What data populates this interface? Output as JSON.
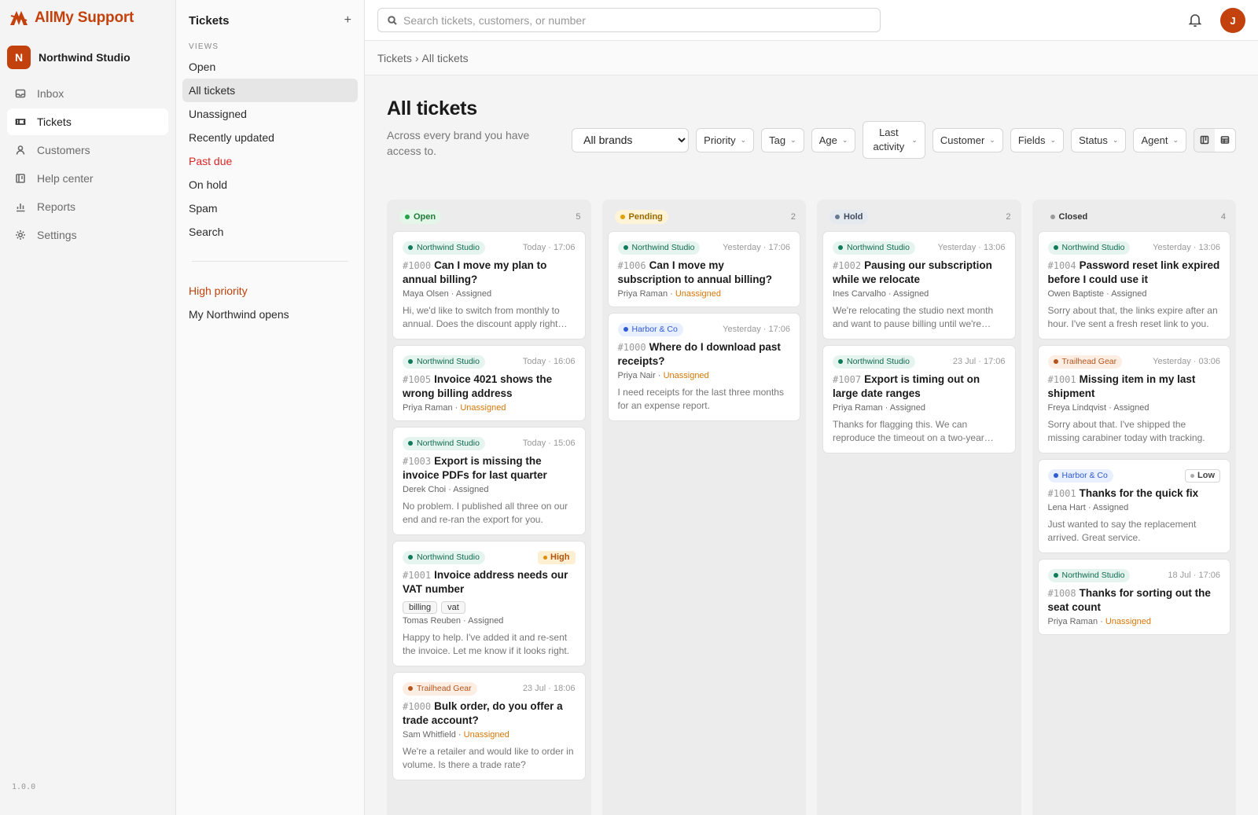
{
  "app": {
    "name": "AllMy Support",
    "version": "1.0.0",
    "accent": "#c2410c"
  },
  "workspace": {
    "initial": "N",
    "name": "Northwind Studio"
  },
  "nav": [
    {
      "label": "Inbox",
      "icon": "inbox-icon",
      "active": false
    },
    {
      "label": "Tickets",
      "icon": "ticket-icon",
      "active": true
    },
    {
      "label": "Customers",
      "icon": "user-icon",
      "active": false
    },
    {
      "label": "Help center",
      "icon": "book-icon",
      "active": false
    },
    {
      "label": "Reports",
      "icon": "bar-chart-icon",
      "active": false
    },
    {
      "label": "Settings",
      "icon": "gear-icon",
      "active": false
    }
  ],
  "views_panel": {
    "title": "Tickets",
    "section_label": "VIEWS",
    "views": [
      {
        "label": "Open",
        "style": "normal",
        "active": false
      },
      {
        "label": "All tickets",
        "style": "normal",
        "active": true
      },
      {
        "label": "Unassigned",
        "style": "normal",
        "active": false
      },
      {
        "label": "Recently updated",
        "style": "normal",
        "active": false
      },
      {
        "label": "Past due",
        "style": "red",
        "active": false
      },
      {
        "label": "On hold",
        "style": "normal",
        "active": false
      },
      {
        "label": "Spam",
        "style": "normal",
        "active": false
      },
      {
        "label": "Search",
        "style": "normal",
        "active": false
      }
    ],
    "saved_views": [
      {
        "label": "High priority",
        "style": "orange"
      },
      {
        "label": "My Northwind opens",
        "style": "normal"
      }
    ]
  },
  "topbar": {
    "search_placeholder": "Search tickets, customers, or number",
    "user_initial": "J"
  },
  "breadcrumb": {
    "root": "Tickets",
    "separator": "›",
    "current": "All tickets"
  },
  "page": {
    "title": "All tickets",
    "subtitle": "Across every brand you have access to."
  },
  "filters": {
    "brand_selected": "All brands",
    "buttons": [
      "Priority",
      "Tag",
      "Age",
      "Last activity",
      "Customer",
      "Fields",
      "Status",
      "Agent"
    ]
  },
  "brands": {
    "Northwind Studio": {
      "bg": "#e6f4ef",
      "fg": "#0f6b4f",
      "dot": "#0f7a59"
    },
    "Harbor & Co": {
      "bg": "#e8efff",
      "fg": "#2f5bd3",
      "dot": "#2f5bd3"
    },
    "Trailhead Gear": {
      "bg": "#fdeee4",
      "fg": "#b4541d",
      "dot": "#b4541d"
    }
  },
  "columns": [
    {
      "status": "Open",
      "count": "5",
      "pill_bg": "#e3f6e8",
      "pill_fg": "#1f7a3a",
      "dot": "#22a34a",
      "cards": [
        {
          "brand": "Northwind Studio",
          "time": "Today · 17:06",
          "num": "#1000",
          "title": "Can I move my plan to annual billing?",
          "customer": "Maya Olsen",
          "assignment": "Assigned",
          "snippet": "Hi, we'd like to switch from monthly to annual. Does the discount apply right away?"
        },
        {
          "brand": "Northwind Studio",
          "time": "Today · 16:06",
          "num": "#1005",
          "title": "Invoice 4021 shows the wrong billing address",
          "customer": "Priya Raman",
          "assignment": "Unassigned",
          "snippet": ""
        },
        {
          "brand": "Northwind Studio",
          "time": "Today · 15:06",
          "num": "#1003",
          "title": "Export is missing the invoice PDFs for last quarter",
          "customer": "Derek Choi",
          "assignment": "Assigned",
          "snippet": "No problem. I published all three on our end and re-ran the export for you."
        },
        {
          "brand": "Northwind Studio",
          "priority": "High",
          "num": "#1001",
          "title": "Invoice address needs our VAT number",
          "tags": [
            "billing",
            "vat"
          ],
          "customer": "Tomas Reuben",
          "assignment": "Assigned",
          "snippet": "Happy to help. I've added it and re-sent the invoice. Let me know if it looks right."
        },
        {
          "brand": "Trailhead Gear",
          "time": "23 Jul · 18:06",
          "num": "#1000",
          "title": "Bulk order, do you offer a trade account?",
          "customer": "Sam Whitfield",
          "assignment": "Unassigned",
          "snippet": "We're a retailer and would like to order in volume. Is there a trade rate?"
        }
      ]
    },
    {
      "status": "Pending",
      "count": "2",
      "pill_bg": "#fdf3d7",
      "pill_fg": "#9a6a00",
      "dot": "#e0a100",
      "cards": [
        {
          "brand": "Northwind Studio",
          "time": "Yesterday · 17:06",
          "num": "#1006",
          "title": "Can I move my subscription to annual billing?",
          "customer": "Priya Raman",
          "assignment": "Unassigned",
          "snippet": ""
        },
        {
          "brand": "Harbor & Co",
          "time": "Yesterday · 17:06",
          "num": "#1000",
          "title": "Where do I download past receipts?",
          "customer": "Priya Nair",
          "assignment": "Unassigned",
          "snippet": "I need receipts for the last three months for an expense report."
        }
      ]
    },
    {
      "status": "Hold",
      "count": "2",
      "pill_bg": "#e4e8ef",
      "pill_fg": "#3f4a5c",
      "dot": "#6b7a90",
      "cards": [
        {
          "brand": "Northwind Studio",
          "time": "Yesterday · 13:06",
          "num": "#1002",
          "title": "Pausing our subscription while we relocate",
          "customer": "Ines Carvalho",
          "assignment": "Assigned",
          "snippet": "We're relocating the studio next month and want to pause billing until we're settled."
        },
        {
          "brand": "Northwind Studio",
          "time": "23 Jul · 17:06",
          "num": "#1007",
          "title": "Export is timing out on large date ranges",
          "customer": "Priya Raman",
          "assignment": "Assigned",
          "snippet": "Thanks for flagging this. We can reproduce the timeout on a two-year range."
        }
      ]
    },
    {
      "status": "Closed",
      "count": "4",
      "pill_bg": "transparent",
      "pill_fg": "#333333",
      "dot": "#999999",
      "cards": [
        {
          "brand": "Northwind Studio",
          "time": "Yesterday · 13:06",
          "num": "#1004",
          "title": "Password reset link expired before I could use it",
          "customer": "Owen Baptiste",
          "assignment": "Assigned",
          "snippet": "Sorry about that, the links expire after an hour. I've sent a fresh reset link to you."
        },
        {
          "brand": "Trailhead Gear",
          "time": "Yesterday · 03:06",
          "num": "#1001",
          "title": "Missing item in my last shipment",
          "customer": "Freya Lindqvist",
          "assignment": "Assigned",
          "snippet": "Sorry about that. I've shipped the missing carabiner today with tracking."
        },
        {
          "brand": "Harbor & Co",
          "priority": "Low",
          "num": "#1001",
          "title": "Thanks for the quick fix",
          "customer": "Lena Hart",
          "assignment": "Assigned",
          "snippet": "Just wanted to say the replacement arrived. Great service."
        },
        {
          "brand": "Northwind Studio",
          "time": "18 Jul · 17:06",
          "num": "#1008",
          "title": "Thanks for sorting out the seat count",
          "customer": "Priya Raman",
          "assignment": "Unassigned",
          "snippet": ""
        }
      ]
    }
  ],
  "priority_styles": {
    "High": {
      "bg": "#fdf0d2",
      "fg": "#b45309",
      "dot": "#e08a00",
      "border": "transparent"
    },
    "Low": {
      "bg": "#ffffff",
      "fg": "#444444",
      "dot": "#aaaaaa",
      "border": "#d6d6d6"
    }
  }
}
